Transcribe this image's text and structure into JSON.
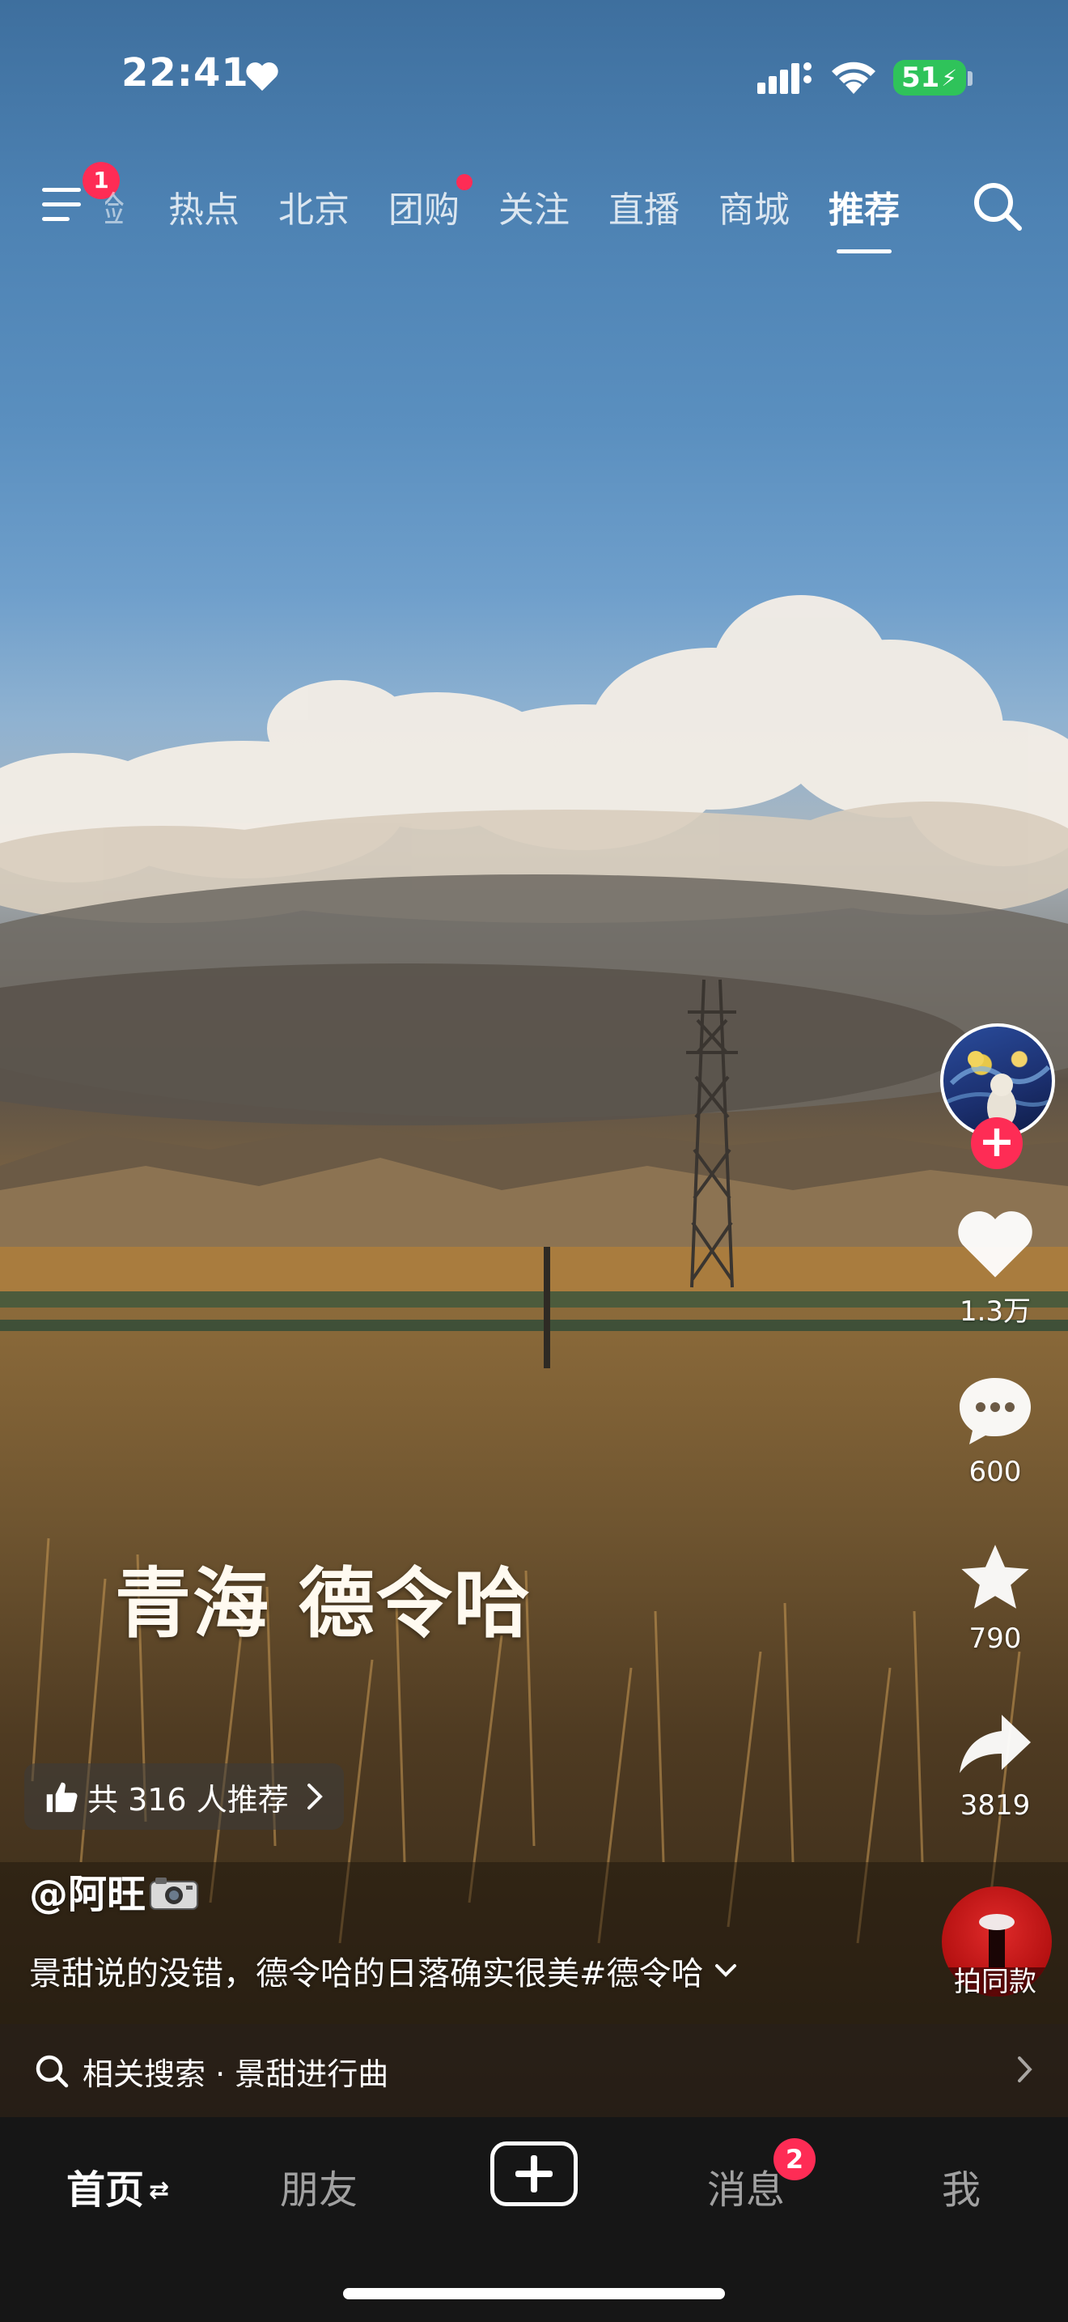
{
  "status_bar": {
    "time": "22:41",
    "battery": "51",
    "icons": [
      "heart-icon",
      "signal-icon",
      "wifi-icon",
      "battery-icon"
    ]
  },
  "top_nav": {
    "menu_badge": "1",
    "tabs": [
      {
        "label": "验",
        "partial": true
      },
      {
        "label": "热点"
      },
      {
        "label": "北京"
      },
      {
        "label": "团购",
        "has_dot": true
      },
      {
        "label": "关注"
      },
      {
        "label": "直播"
      },
      {
        "label": "商城"
      },
      {
        "label": "推荐",
        "active": true
      }
    ]
  },
  "video": {
    "caption_overlay": "青海 德令哈",
    "recommend_text": "共 316 人推荐",
    "author": "@阿旺",
    "description": "景甜说的没错，德令哈的日落确实很美#德令哈",
    "related_search": "相关搜索 · 景甜进行曲"
  },
  "actions": {
    "likes": "1.3万",
    "comments": "600",
    "favorites": "790",
    "shares": "3819",
    "same_style_label": "拍同款"
  },
  "tab_bar": {
    "home": "首页",
    "friends": "朋友",
    "messages": "消息",
    "messages_badge": "2",
    "me": "我"
  },
  "colors": {
    "accent": "#fe2c55",
    "battery": "#2fc35a",
    "tabbar_bg": "#161616"
  }
}
